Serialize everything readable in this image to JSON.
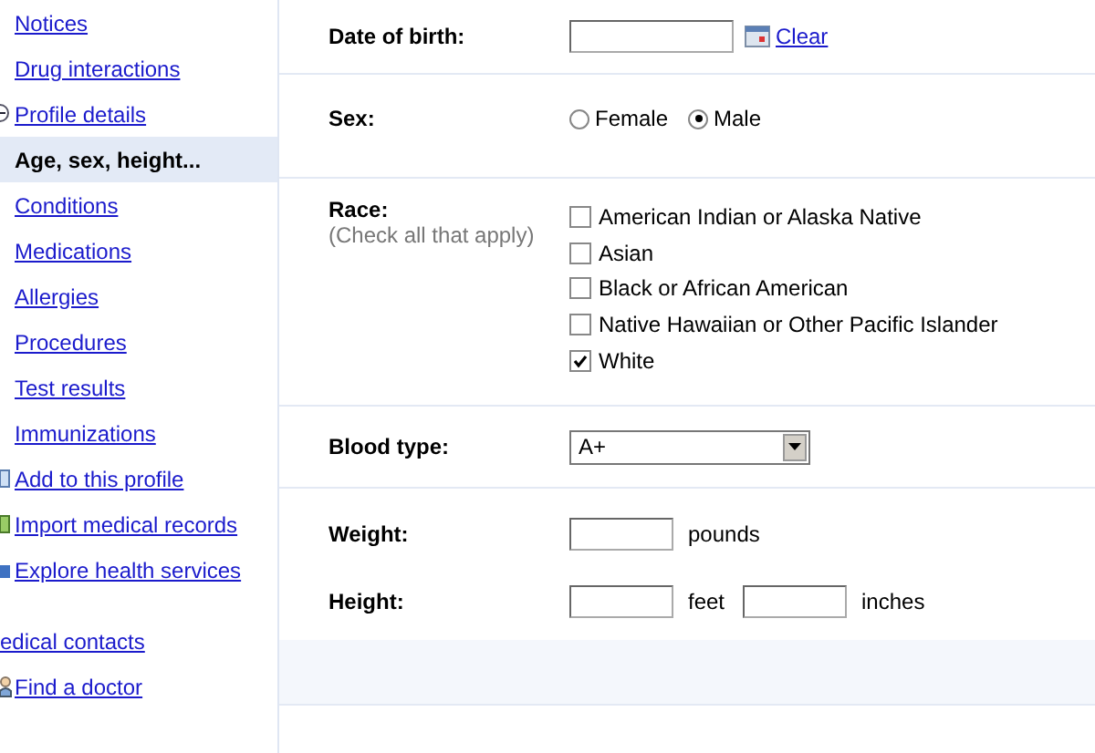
{
  "sidebar": {
    "items": [
      {
        "label": "Notices",
        "kind": "link",
        "selected": false
      },
      {
        "label": "Drug interactions",
        "kind": "link",
        "selected": false
      },
      {
        "label": "Profile details",
        "kind": "toggle",
        "selected": false
      },
      {
        "label": "Age, sex, height...",
        "kind": "link",
        "selected": true
      },
      {
        "label": "Conditions",
        "kind": "link",
        "selected": false
      },
      {
        "label": "Medications",
        "kind": "link",
        "selected": false
      },
      {
        "label": "Allergies",
        "kind": "link",
        "selected": false
      },
      {
        "label": "Procedures",
        "kind": "link",
        "selected": false
      },
      {
        "label": "Test results",
        "kind": "link",
        "selected": false
      },
      {
        "label": "Immunizations",
        "kind": "link",
        "selected": false
      },
      {
        "label": "Add to this profile",
        "kind": "add",
        "selected": false
      },
      {
        "label": "Import medical records",
        "kind": "import",
        "selected": false
      },
      {
        "label": "Explore health services",
        "kind": "explore",
        "selected": false
      }
    ],
    "contacts": [
      {
        "label": "edical contacts",
        "kind": "link"
      },
      {
        "label": "Find a doctor",
        "kind": "doctor"
      }
    ]
  },
  "form": {
    "date_of_birth": {
      "label": "Date of birth:",
      "link": "Clear"
    },
    "sex": {
      "label": "Sex:",
      "options": [
        {
          "label": "Female",
          "selected": false
        },
        {
          "label": "Male",
          "selected": true
        }
      ]
    },
    "race": {
      "label": "Race:",
      "hint": "(Check all that apply)",
      "options": [
        {
          "label": "American Indian or Alaska Native",
          "checked": false
        },
        {
          "label": "Asian",
          "checked": false
        },
        {
          "label": "Black or African American",
          "checked": false
        },
        {
          "label": "Native Hawaiian or Other Pacific Islander",
          "checked": false
        },
        {
          "label": "White",
          "checked": true
        }
      ]
    },
    "blood_type": {
      "label": "Blood type:",
      "value": "A+"
    },
    "weight": {
      "label": "Weight:",
      "unit": "pounds"
    },
    "height": {
      "label": "Height:",
      "units": [
        "feet",
        "inches"
      ]
    }
  }
}
